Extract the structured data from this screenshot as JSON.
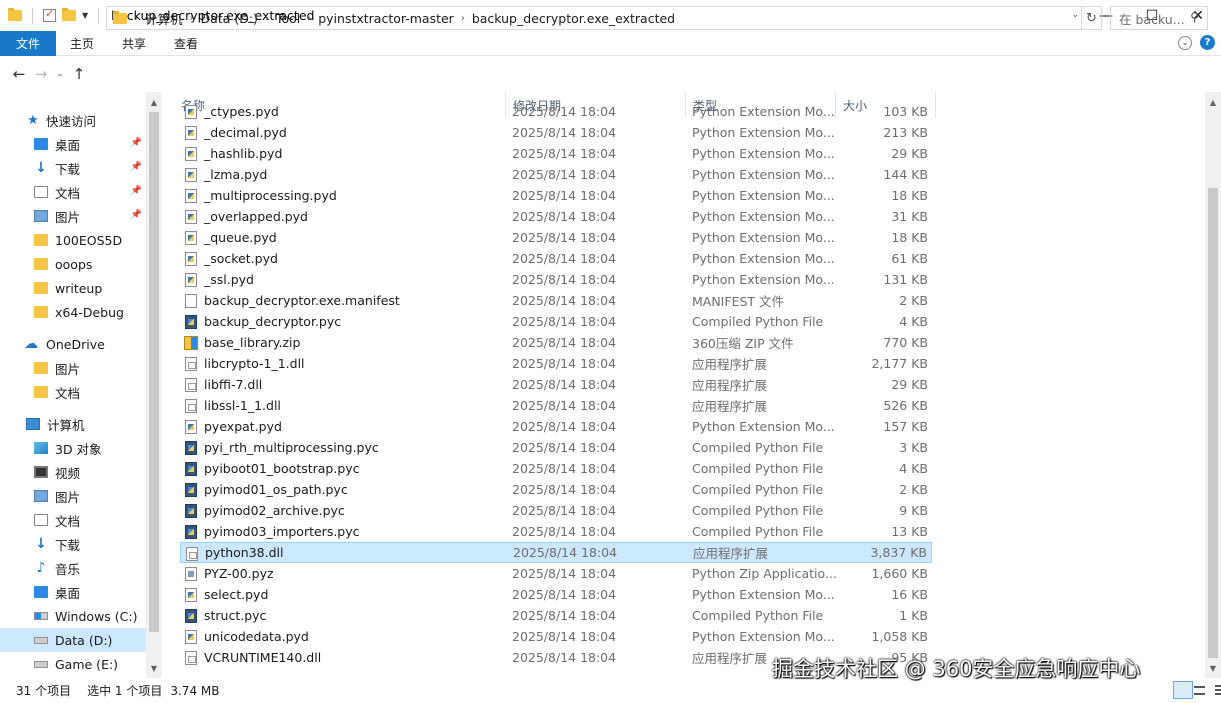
{
  "window": {
    "title": "backup_decryptor.exe_extracted",
    "minimize_icon": "minimize-icon",
    "maximize_icon": "maximize-icon",
    "close_icon": "close-icon"
  },
  "ribbon": {
    "tabs": [
      "文件",
      "主页",
      "共享",
      "查看"
    ]
  },
  "address": {
    "crumbs": [
      "计算机",
      "Data (D:)",
      "Tool",
      "pyinstxtractor-master",
      "backup_decryptor.exe_extracted"
    ]
  },
  "search": {
    "placeholder": "在 backu..."
  },
  "columns": {
    "name": "名称",
    "date": "修改日期",
    "type": "类型",
    "size": "大小"
  },
  "nav": {
    "quick_access": "快速访问",
    "desktop": "桌面",
    "downloads": "下载",
    "documents": "文档",
    "pictures": "图片",
    "f1": "100EOS5D",
    "f2": "ooops",
    "f3": "writeup",
    "f4": "x64-Debug",
    "onedrive": "OneDrive",
    "od_pictures": "图片",
    "od_documents": "文档",
    "computer": "计算机",
    "objects3d": "3D 对象",
    "videos": "视频",
    "pc_pictures": "图片",
    "pc_documents": "文档",
    "pc_downloads": "下载",
    "music": "音乐",
    "pc_desktop": "桌面",
    "drive_c": "Windows (C:)",
    "drive_d": "Data (D:)",
    "drive_e": "Game (E:)"
  },
  "files": [
    {
      "name": "_ctypes.pyd",
      "date": "2025/8/14 18:04",
      "type": "Python Extension Mo...",
      "size": "103 KB",
      "icon": "pyd"
    },
    {
      "name": "_decimal.pyd",
      "date": "2025/8/14 18:04",
      "type": "Python Extension Mo...",
      "size": "213 KB",
      "icon": "pyd"
    },
    {
      "name": "_hashlib.pyd",
      "date": "2025/8/14 18:04",
      "type": "Python Extension Mo...",
      "size": "29 KB",
      "icon": "pyd"
    },
    {
      "name": "_lzma.pyd",
      "date": "2025/8/14 18:04",
      "type": "Python Extension Mo...",
      "size": "144 KB",
      "icon": "pyd"
    },
    {
      "name": "_multiprocessing.pyd",
      "date": "2025/8/14 18:04",
      "type": "Python Extension Mo...",
      "size": "18 KB",
      "icon": "pyd"
    },
    {
      "name": "_overlapped.pyd",
      "date": "2025/8/14 18:04",
      "type": "Python Extension Mo...",
      "size": "31 KB",
      "icon": "pyd"
    },
    {
      "name": "_queue.pyd",
      "date": "2025/8/14 18:04",
      "type": "Python Extension Mo...",
      "size": "18 KB",
      "icon": "pyd"
    },
    {
      "name": "_socket.pyd",
      "date": "2025/8/14 18:04",
      "type": "Python Extension Mo...",
      "size": "61 KB",
      "icon": "pyd"
    },
    {
      "name": "_ssl.pyd",
      "date": "2025/8/14 18:04",
      "type": "Python Extension Mo...",
      "size": "131 KB",
      "icon": "pyd"
    },
    {
      "name": "backup_decryptor.exe.manifest",
      "date": "2025/8/14 18:04",
      "type": "MANIFEST 文件",
      "size": "2 KB",
      "icon": "file"
    },
    {
      "name": "backup_decryptor.pyc",
      "date": "2025/8/14 18:04",
      "type": "Compiled Python File",
      "size": "4 KB",
      "icon": "pyc"
    },
    {
      "name": "base_library.zip",
      "date": "2025/8/14 18:04",
      "type": "360压缩 ZIP 文件",
      "size": "770 KB",
      "icon": "zip"
    },
    {
      "name": "libcrypto-1_1.dll",
      "date": "2025/8/14 18:04",
      "type": "应用程序扩展",
      "size": "2,177 KB",
      "icon": "dll"
    },
    {
      "name": "libffi-7.dll",
      "date": "2025/8/14 18:04",
      "type": "应用程序扩展",
      "size": "29 KB",
      "icon": "dll"
    },
    {
      "name": "libssl-1_1.dll",
      "date": "2025/8/14 18:04",
      "type": "应用程序扩展",
      "size": "526 KB",
      "icon": "dll"
    },
    {
      "name": "pyexpat.pyd",
      "date": "2025/8/14 18:04",
      "type": "Python Extension Mo...",
      "size": "157 KB",
      "icon": "pyd"
    },
    {
      "name": "pyi_rth_multiprocessing.pyc",
      "date": "2025/8/14 18:04",
      "type": "Compiled Python File",
      "size": "3 KB",
      "icon": "pyc"
    },
    {
      "name": "pyiboot01_bootstrap.pyc",
      "date": "2025/8/14 18:04",
      "type": "Compiled Python File",
      "size": "4 KB",
      "icon": "pyc"
    },
    {
      "name": "pyimod01_os_path.pyc",
      "date": "2025/8/14 18:04",
      "type": "Compiled Python File",
      "size": "2 KB",
      "icon": "pyc"
    },
    {
      "name": "pyimod02_archive.pyc",
      "date": "2025/8/14 18:04",
      "type": "Compiled Python File",
      "size": "9 KB",
      "icon": "pyc"
    },
    {
      "name": "pyimod03_importers.pyc",
      "date": "2025/8/14 18:04",
      "type": "Compiled Python File",
      "size": "13 KB",
      "icon": "pyc"
    },
    {
      "name": "python38.dll",
      "date": "2025/8/14 18:04",
      "type": "应用程序扩展",
      "size": "3,837 KB",
      "icon": "dll",
      "selected": true
    },
    {
      "name": "PYZ-00.pyz",
      "date": "2025/8/14 18:04",
      "type": "Python Zip Applicatio...",
      "size": "1,660 KB",
      "icon": "pyz"
    },
    {
      "name": "select.pyd",
      "date": "2025/8/14 18:04",
      "type": "Python Extension Mo...",
      "size": "16 KB",
      "icon": "pyd"
    },
    {
      "name": "struct.pyc",
      "date": "2025/8/14 18:04",
      "type": "Compiled Python File",
      "size": "1 KB",
      "icon": "pyc"
    },
    {
      "name": "unicodedata.pyd",
      "date": "2025/8/14 18:04",
      "type": "Python Extension Mo...",
      "size": "1,058 KB",
      "icon": "pyd"
    },
    {
      "name": "VCRUNTIME140.dll",
      "date": "2025/8/14 18:04",
      "type": "应用程序扩展",
      "size": "95 KB",
      "icon": "dll"
    }
  ],
  "status": {
    "count": "31 个项目",
    "selection": "选中 1 个项目",
    "size": "3.74 MB"
  },
  "watermark": "掘金技术社区 @ 360安全应急响应中心"
}
